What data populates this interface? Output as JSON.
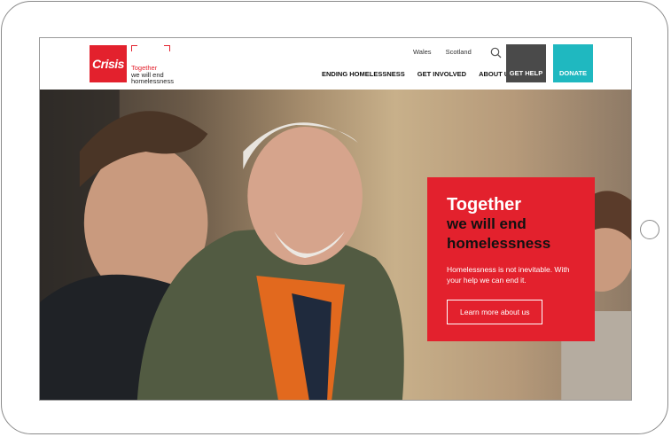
{
  "header": {
    "logo_text": "Crisis",
    "tagline_line1": "Together",
    "tagline_line2": "we will end",
    "tagline_line3": "homelessness",
    "top_links": [
      "Wales",
      "Scotland"
    ],
    "nav": [
      "ENDING HOMELESSNESS",
      "GET INVOLVED",
      "ABOUT US"
    ],
    "get_help_label": "GET HELP",
    "donate_label": "DONATE"
  },
  "hero": {
    "title_line1": "Together",
    "title_line2": "we will end",
    "title_line3": "homelessness",
    "body": "Homelessness is not inevitable. With your help we can end it.",
    "cta_label": "Learn more about us"
  },
  "colors": {
    "brand_red": "#e3212d",
    "help_gray": "#4a4a4a",
    "donate_teal": "#1fb8c0"
  },
  "icons": [
    "search-icon"
  ]
}
